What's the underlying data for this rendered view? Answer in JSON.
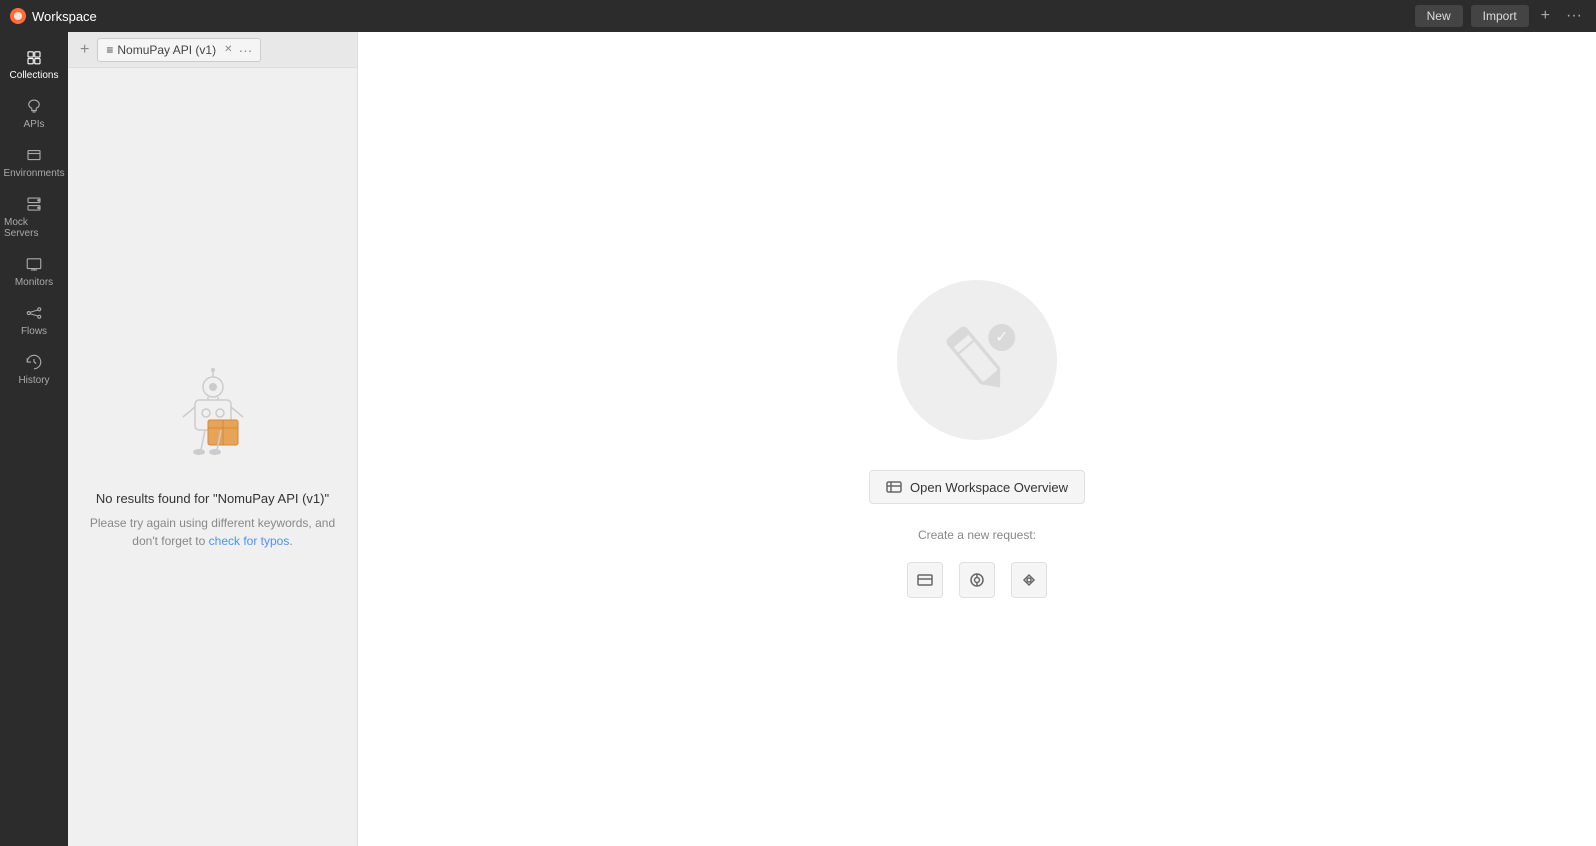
{
  "topbar": {
    "workspace_label": "Workspace",
    "new_button": "New",
    "import_button": "Import",
    "logo_icon": "●"
  },
  "sidebar": {
    "items": [
      {
        "id": "collections",
        "label": "Collections",
        "active": true
      },
      {
        "id": "apis",
        "label": "APIs",
        "active": false
      },
      {
        "id": "environments",
        "label": "Environments",
        "active": false
      },
      {
        "id": "mock-servers",
        "label": "Mock Servers",
        "active": false
      },
      {
        "id": "monitors",
        "label": "Monitors",
        "active": false
      },
      {
        "id": "flows",
        "label": "Flows",
        "active": false
      },
      {
        "id": "history",
        "label": "History",
        "active": false
      }
    ]
  },
  "left_panel": {
    "tab": {
      "icon": "≡",
      "label": "NomuPay API (v1)"
    }
  },
  "no_results": {
    "title": "No results found for \"NomuPay API (v1)\"",
    "description_part1": "Please try again using different keywords, and",
    "description_part2": "don't forget to ",
    "link_text": "check for typos",
    "description_part3": "."
  },
  "main": {
    "open_workspace_label": "Open Workspace Overview",
    "create_request_label": "Create a new request:",
    "req_icons": [
      {
        "id": "http-request",
        "symbol": "⊞"
      },
      {
        "id": "graphql",
        "symbol": "◎"
      },
      {
        "id": "grpc",
        "symbol": "⚙"
      }
    ]
  },
  "colors": {
    "accent": "#ff6c37",
    "sidebar_bg": "#2c2c2c",
    "panel_bg": "#f0f0f0",
    "main_bg": "#ffffff"
  }
}
